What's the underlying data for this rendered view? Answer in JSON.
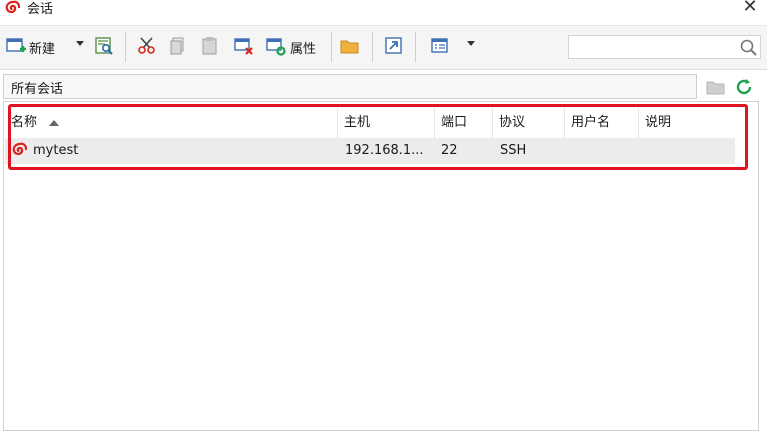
{
  "window": {
    "title": "会话",
    "close_label": "✕"
  },
  "toolbar": {
    "new_label": "新建",
    "properties_label": "属性",
    "icons": [
      "new-session-icon",
      "dropdown-caret",
      "find-session-icon",
      "cut-icon",
      "copy-icon",
      "paste-icon",
      "delete-icon",
      "properties-icon",
      "open-folder-icon",
      "shortcut-icon",
      "view-icon",
      "dropdown-caret"
    ]
  },
  "search": {
    "placeholder": "",
    "value": ""
  },
  "path": {
    "text": "所有会话"
  },
  "table": {
    "columns": [
      "名称",
      "主机",
      "端口",
      "协议",
      "用户名",
      "说明"
    ],
    "sort_column": "名称",
    "rows": [
      {
        "name": "mytest",
        "host": "192.168.1...",
        "port": "22",
        "protocol": "SSH",
        "user": "",
        "note": ""
      }
    ]
  },
  "colors": {
    "highlight_border": "#e0141e",
    "row_selected_bg": "#ececec",
    "accent_green": "#1aa34a"
  }
}
